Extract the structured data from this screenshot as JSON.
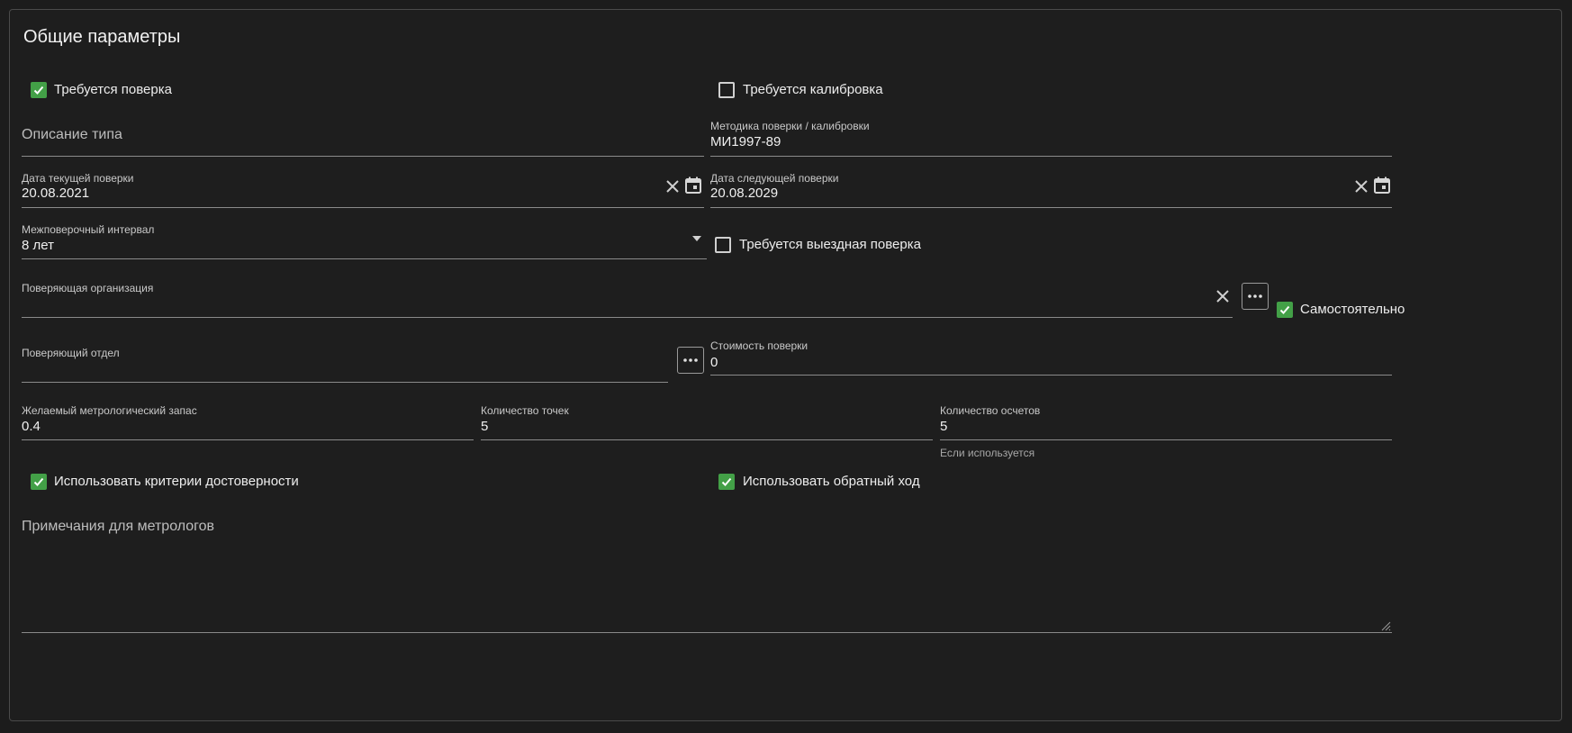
{
  "section": {
    "title": "Общие параметры"
  },
  "checkboxes": {
    "verification_required": {
      "label": "Требуется поверка",
      "checked": true
    },
    "calibration_required": {
      "label": "Требуется калибровка",
      "checked": false
    },
    "field_verification": {
      "label": "Требуется выездная поверка",
      "checked": false
    },
    "self": {
      "label": "Самостоятельно",
      "checked": true
    },
    "reliability_criteria": {
      "label": "Использовать критерии достоверности",
      "checked": true
    },
    "reverse_stroke": {
      "label": "Использовать обратный ход",
      "checked": true
    }
  },
  "fields": {
    "type_description": {
      "placeholder": "Описание типа",
      "value": ""
    },
    "method": {
      "label": "Методика поверки / калибровки",
      "value": "МИ1997-89"
    },
    "current_date": {
      "label": "Дата текущей поверки",
      "value": "20.08.2021"
    },
    "next_date": {
      "label": "Дата следующей поверки",
      "value": "20.08.2029"
    },
    "interval": {
      "label": "Межповерочный интервал",
      "value": "8 лет"
    },
    "organization": {
      "label": "Поверяющая организация",
      "value": ""
    },
    "department": {
      "label": "Поверяющий отдел",
      "value": ""
    },
    "cost": {
      "label": "Стоимость поверки",
      "value": "0"
    },
    "reserve": {
      "label": "Желаемый метрологический запас",
      "value": "0.4"
    },
    "points": {
      "label": "Количество точек",
      "value": "5"
    },
    "readings": {
      "label": "Количество осчетов",
      "value": "5",
      "hint": "Если используется"
    },
    "notes": {
      "placeholder": "Примечания для метрологов",
      "value": ""
    }
  },
  "colors": {
    "accent": "#43a047",
    "background": "#1e1e1e"
  }
}
